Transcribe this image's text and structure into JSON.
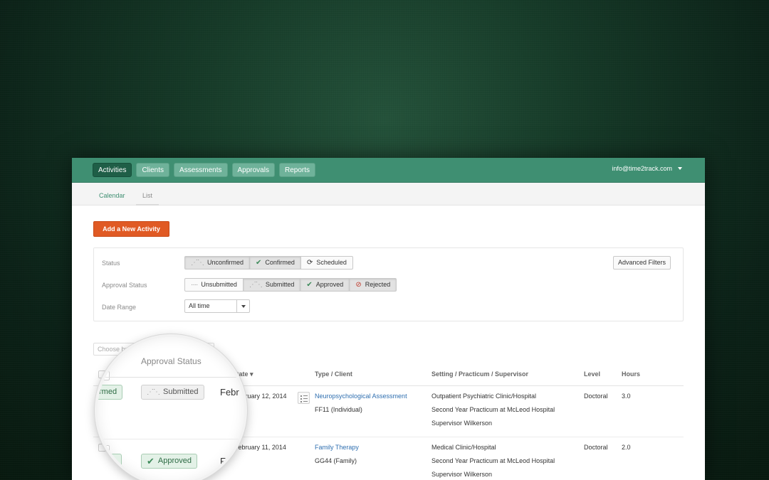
{
  "topnav": {
    "tabs": [
      {
        "label": "Activities",
        "active": true
      },
      {
        "label": "Clients",
        "active": false
      },
      {
        "label": "Assessments",
        "active": false
      },
      {
        "label": "Approvals",
        "active": false
      },
      {
        "label": "Reports",
        "active": false
      }
    ],
    "user_email": "info@time2track.com"
  },
  "subnav": {
    "tabs": [
      {
        "label": "Calendar",
        "active": true
      },
      {
        "label": "List",
        "active": false
      }
    ]
  },
  "add_button": "Add a New Activity",
  "filters": {
    "status": {
      "label": "Status",
      "options": [
        {
          "label": "Unconfirmed",
          "icon": "dotted-check-icon",
          "selected": true
        },
        {
          "label": "Confirmed",
          "icon": "check-icon",
          "selected": true
        },
        {
          "label": "Scheduled",
          "icon": "refresh-icon",
          "selected": false
        }
      ]
    },
    "approval_status": {
      "label": "Approval Status",
      "options": [
        {
          "label": "Unsubmitted",
          "icon": "dashed-line-icon",
          "selected": false
        },
        {
          "label": "Submitted",
          "icon": "dotted-check-icon",
          "selected": true
        },
        {
          "label": "Approved",
          "icon": "check-icon",
          "selected": true
        },
        {
          "label": "Rejected",
          "icon": "ban-icon",
          "selected": true
        }
      ]
    },
    "date_range": {
      "label": "Date Range",
      "value": "All time"
    },
    "advanced_button": "Advanced Filters"
  },
  "bulk_action": {
    "placeholder": "Choose bulk"
  },
  "table": {
    "headers": {
      "date": "Date ▾",
      "type_client": "Type / Client",
      "setting": "Setting / Practicum / Supervisor",
      "level": "Level",
      "hours": "Hours"
    },
    "rows": [
      {
        "date": "February 12, 2014",
        "type": "Neuropsychological Assessment",
        "client": "FF11 (Individual)",
        "setting": "Outpatient Psychiatric Clinic/Hospital",
        "practicum": "Second Year Practicum at McLeod Hospital",
        "supervisor": "Supervisor Wilkerson",
        "level": "Doctoral",
        "hours": "3.0"
      },
      {
        "date": "February 11, 2014",
        "type": "Family Therapy",
        "client": "GG44 (Family)",
        "setting": "Medical Clinic/Hospital",
        "practicum": "Second Year Practicum at McLeod Hospital",
        "supervisor": "Supervisor Wilkerson",
        "level": "Doctoral",
        "hours": "2.0"
      }
    ]
  },
  "magnifier": {
    "header": "Approval Status",
    "row1": {
      "status_cut": "rmed",
      "approval": "Submitted",
      "date_cut": "Febr"
    },
    "row2": {
      "approval": "Approved",
      "date_cut": "F"
    }
  },
  "colors": {
    "nav_green": "#3f8f72",
    "active_tab": "#1f5e47",
    "accent_orange": "#e05a24",
    "link_blue": "#2f6fb0"
  }
}
